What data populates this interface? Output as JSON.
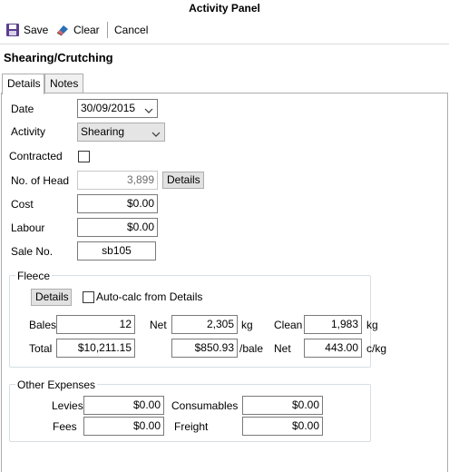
{
  "window": {
    "title": "Activity Panel"
  },
  "toolbar": {
    "save_label": "Save",
    "clear_label": "Clear",
    "cancel_label": "Cancel"
  },
  "section_title": "Shearing/Crutching",
  "tabs": [
    {
      "label": "Details",
      "active": true
    },
    {
      "label": "Notes",
      "active": false
    }
  ],
  "form": {
    "date_label": "Date",
    "date_value": "30/09/2015",
    "activity_label": "Activity",
    "activity_value": "Shearing",
    "contracted_label": "Contracted",
    "contracted_checked": false,
    "head_label": "No. of Head",
    "head_value": "3,899",
    "head_details_button": "Details",
    "cost_label": "Cost",
    "cost_value": "$0.00",
    "labour_label": "Labour",
    "labour_value": "$0.00",
    "sale_label": "Sale No.",
    "sale_value": "sb105"
  },
  "fleece": {
    "title": "Fleece",
    "details_button": "Details",
    "autocalc_label": "Auto-calc from Details",
    "autocalc_checked": false,
    "bales_label": "Bales",
    "bales_value": "12",
    "net_label": "Net",
    "net_value": "2,305",
    "net_unit": "kg",
    "clean_label": "Clean",
    "clean_value": "1,983",
    "clean_unit": "kg",
    "total_label": "Total",
    "total_value": "$10,211.15",
    "per_bale_value": "$850.93",
    "per_bale_unit": "/bale",
    "net_price_label": "Net",
    "net_price_value": "443.00",
    "net_price_unit": "c/kg"
  },
  "other_expenses": {
    "title": "Other Expenses",
    "levies_label": "Levies",
    "levies_value": "$0.00",
    "consumables_label": "Consumables",
    "consumables_value": "$0.00",
    "fees_label": "Fees",
    "fees_value": "$0.00",
    "freight_label": "Freight",
    "freight_value": "$0.00"
  },
  "icons": {
    "save": "floppy-disk-icon",
    "clear": "eraser-icon",
    "dropdown": "chevron-down-icon"
  },
  "colors": {
    "save_icon": "#5c3f8f",
    "clear_icon": "#2c6fb5",
    "group_border": "#d5dfe5"
  }
}
